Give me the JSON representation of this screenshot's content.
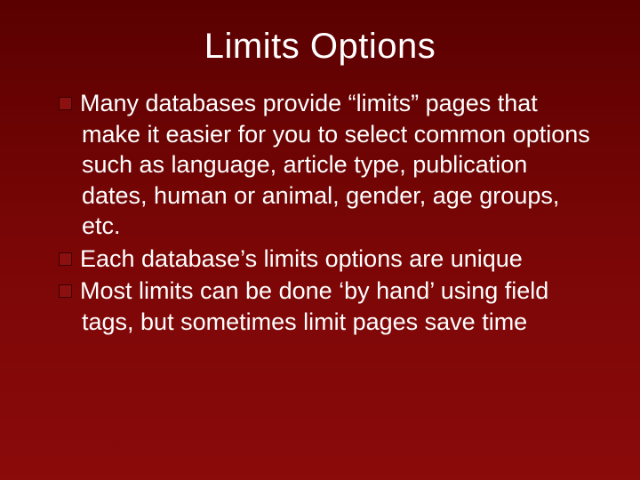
{
  "title": "Limits Options",
  "bullets": [
    "Many databases provide “limits” pages that make it easier for you to select common options such as language, article type, publication dates, human or animal, gender, age groups, etc.",
    "Each database’s limits options are unique",
    "Most limits can be done ‘by hand’ using field tags, but sometimes limit pages save time"
  ]
}
